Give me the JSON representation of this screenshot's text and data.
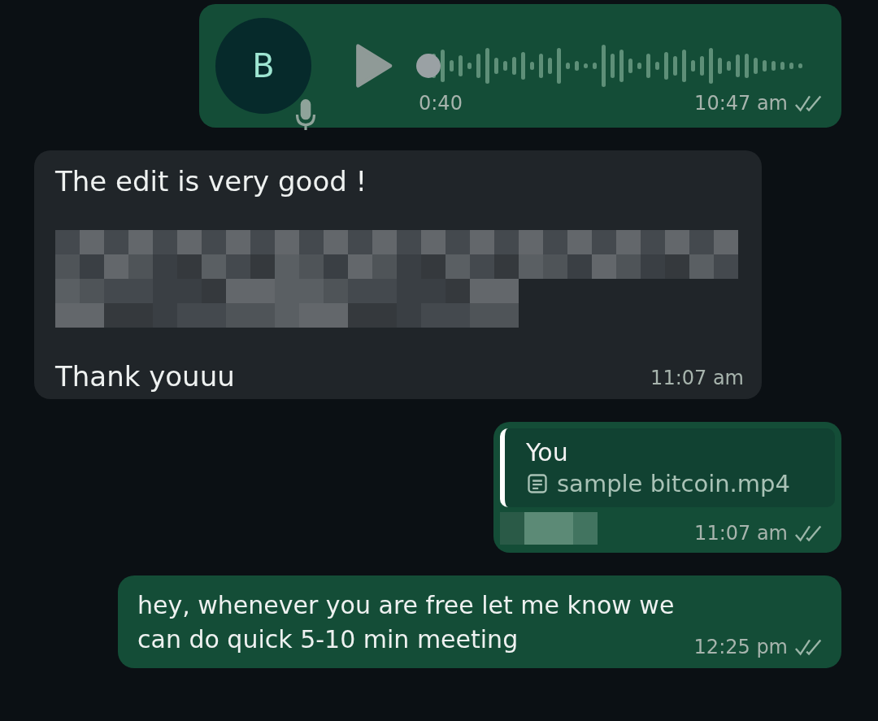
{
  "messages": [
    {
      "kind": "voice",
      "outgoing": true,
      "avatar_letter": "B",
      "duration": "0:40",
      "time": "10:47 am",
      "read": false,
      "level": 0
    },
    {
      "kind": "text",
      "outgoing": false,
      "lines": [
        "The edit is very good !"
      ],
      "redacted": true,
      "lines_after": [
        "Thank youuu"
      ],
      "time": "11:07 am"
    },
    {
      "kind": "reply",
      "outgoing": true,
      "quote_author": "You",
      "quote_file": "sample bitcoin.mp4",
      "redacted": true,
      "time": "11:07 am",
      "read": false
    },
    {
      "kind": "plain",
      "outgoing": true,
      "text": "hey, whenever you are free let me know we can do quick 5-10 min meeting",
      "time": "12:25 pm",
      "read": false
    }
  ]
}
